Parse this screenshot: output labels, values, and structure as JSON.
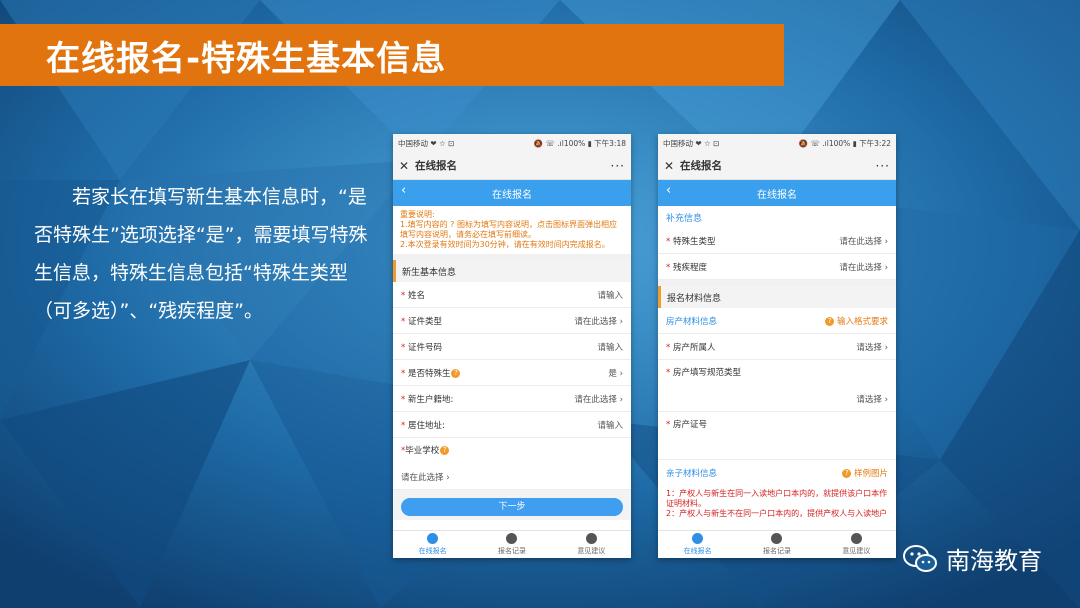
{
  "title": "在线报名-特殊生基本信息",
  "description": "若家长在填写新生基本信息时，“是否特殊生”选项选择“是”，需要填写特殊生信息，特殊生信息包括“特殊生类型（可多选）”、“残疾程度”。",
  "brand": "南海教育",
  "phone1": {
    "status_left": "中国移动 ❤ ☆ ⊡",
    "status_right": "🔕 ☏ .ıl100% ▮ 下午3:18",
    "app_title": "在线报名",
    "nav_title": "在线报名",
    "notice": "重要说明:\n1.填写内容的 ? 图标为填写内容说明，点击图标界面弹出相应填写内容说明，请务必在填写前细读。\n2.本次登录有效时间为30分钟，请在有效时间内完成报名。",
    "section": "新生基本信息",
    "rows": [
      {
        "label": "姓名",
        "value": "请输入"
      },
      {
        "label": "证件类型",
        "value": "请在此选择 ›"
      },
      {
        "label": "证件号码",
        "value": "请输入"
      },
      {
        "label": "是否特殊生",
        "value": "是 ›"
      },
      {
        "label": "新生户籍地:",
        "value": "请在此选择 ›"
      },
      {
        "label": "居住地址:",
        "value": "请输入"
      }
    ],
    "school_label": "毕业学校",
    "school_value": "请在此选择 ›",
    "next_button": "下一步"
  },
  "phone2": {
    "status_left": "中国移动 ❤ ☆ ⊡",
    "status_right": "🔕 ☏ .ıl100% ▮ 下午3:22",
    "app_title": "在线报名",
    "nav_title": "在线报名",
    "supp_section": "补充信息",
    "supp_rows": [
      {
        "label": "特殊生类型",
        "value": "请在此选择 ›"
      },
      {
        "label": "残疾程度",
        "value": "请在此选择 ›"
      }
    ],
    "material_section": "报名材料信息",
    "property_section": "房产材料信息",
    "property_link": "输入格式要求",
    "property_rows": [
      {
        "label": "房产所属人",
        "value": "请选择 ›"
      }
    ],
    "property_type_label": "房产填写规范类型",
    "property_type_value": "请选择 ›",
    "property_cert_label": "房产证号",
    "kin_section": "亲子材料信息",
    "kin_link": "样例图片",
    "kin_note": "1：产权人与新生在同一入读地户口本内的，就提供该户口本作证明材料。\n2：产权人与新生不在同一户口本内的，提供产权人与入读地户口本内新生关系的证明材料，（如结婚证、出生"
  },
  "tabs": [
    "在线报名",
    "报名记录",
    "意见建议"
  ]
}
